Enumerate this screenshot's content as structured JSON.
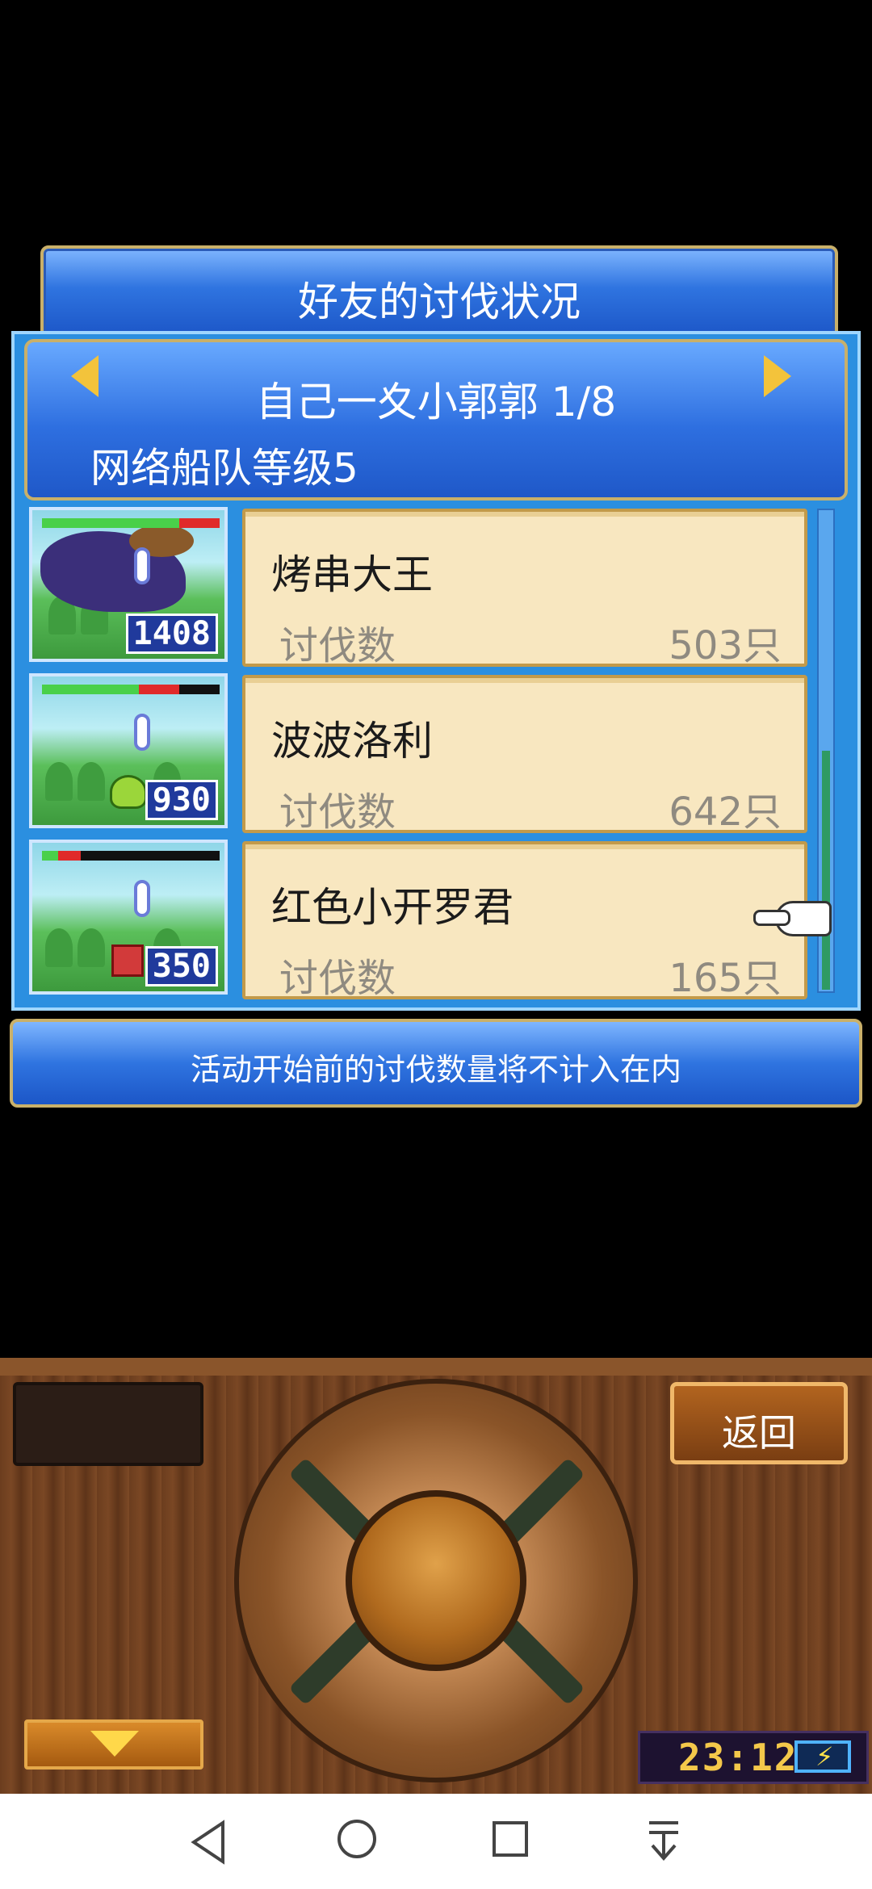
{
  "title": "好友的讨伐状况",
  "friend": {
    "name_page": "自己一夊小郭郭 1/8",
    "fleet_level": "网络船队等级5"
  },
  "entries": [
    {
      "name": "烤串大王",
      "label": "讨伐数",
      "count": "503只",
      "thumb_number": "1408"
    },
    {
      "name": "波波洛利",
      "label": "讨伐数",
      "count": "642只",
      "thumb_number": "930"
    },
    {
      "name": "红色小开罗君",
      "label": "讨伐数",
      "count": "165只",
      "thumb_number": "350"
    }
  ],
  "notice": "活动开始前的讨伐数量将不计入在内",
  "controller": {
    "back_label": "返回",
    "clock": "23:12"
  },
  "icons": {
    "prev": "arrow-left-icon",
    "next": "arrow-right-icon",
    "pointer": "hand-pointer-icon",
    "battery": "battery-charging-icon"
  },
  "colors": {
    "banner_blue": "#2f74e0",
    "panel_blue": "#2b8fe0",
    "card_bg": "#f8e7c0",
    "gold": "#c9b06a",
    "wood": "#6b3d1e"
  }
}
